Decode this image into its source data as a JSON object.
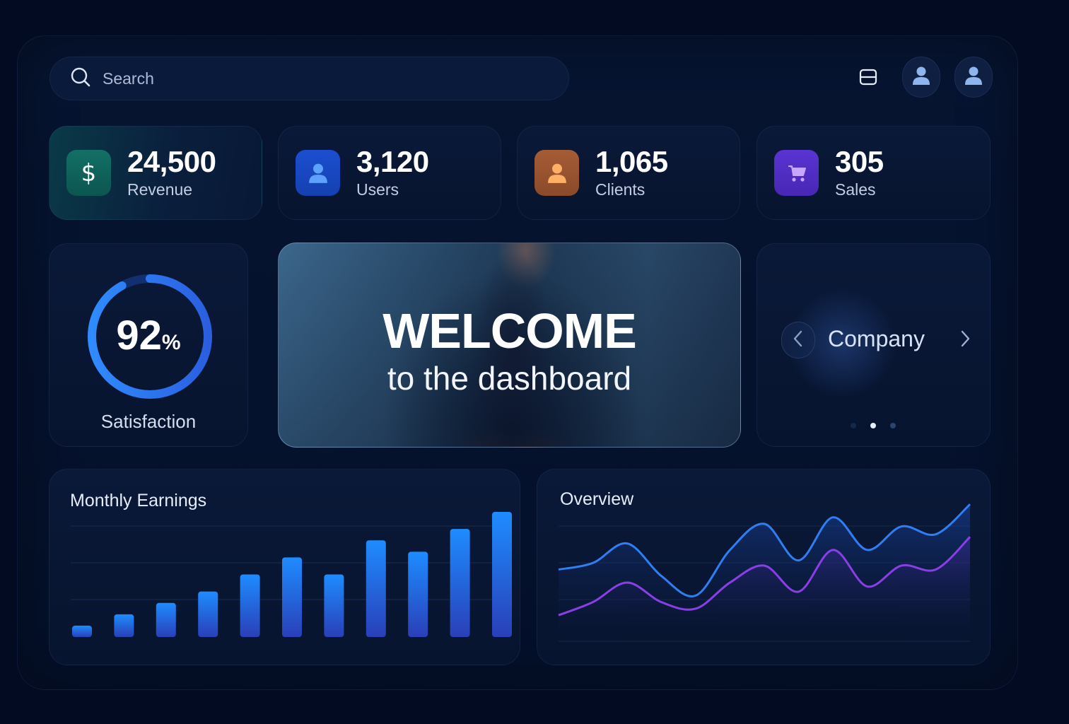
{
  "search": {
    "placeholder": "Search",
    "icon": "search-icon"
  },
  "header": {
    "icons": [
      "window-icon",
      "user-icon",
      "user-icon"
    ]
  },
  "stats": [
    {
      "value": "24,500",
      "label": "Revenue",
      "icon": "dollar-icon",
      "color": "#0f5a56"
    },
    {
      "value": "3,120",
      "label": "Users",
      "icon": "user-icon",
      "color": "#1f5fe0"
    },
    {
      "value": "1,065",
      "label": "Clients",
      "icon": "user-icon",
      "color": "#d9834a"
    },
    {
      "value": "305",
      "label": "Sales",
      "icon": "cart-icon",
      "color": "#5a3ad6"
    }
  ],
  "satisfaction": {
    "value": "92",
    "unit": "%",
    "label": "Satisfaction",
    "progress": 0.92
  },
  "welcome": {
    "title": "WELCOME",
    "subtitle": "to the dashboard"
  },
  "company": {
    "name": "Company",
    "page": 2,
    "pages": 3
  },
  "chart_data": [
    {
      "type": "bar",
      "title": "Monthly Earnings",
      "values": [
        2,
        4,
        6,
        8,
        11,
        14,
        11,
        17,
        15,
        19,
        22
      ],
      "ylim": [
        0,
        22
      ],
      "grid": true
    },
    {
      "type": "line",
      "title": "Overview",
      "x": [
        0,
        1,
        2,
        3,
        4,
        5,
        6,
        7,
        8,
        9,
        10,
        11,
        12
      ],
      "series": [
        {
          "values": [
            55,
            60,
            75,
            50,
            35,
            70,
            90,
            62,
            95,
            70,
            88,
            82,
            105
          ]
        },
        {
          "values": [
            20,
            30,
            45,
            30,
            25,
            45,
            58,
            38,
            70,
            42,
            58,
            55,
            80
          ]
        }
      ],
      "ylim": [
        0,
        110
      ],
      "grid": true,
      "colors": [
        "#2f7ef2",
        "#8a3fe6"
      ]
    }
  ]
}
